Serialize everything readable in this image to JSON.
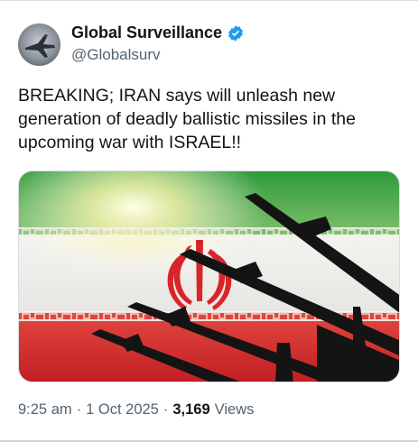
{
  "author": {
    "display_name": "Global Surveillance",
    "handle": "@Globalsurv",
    "verified": true,
    "avatar_icon": "fighter-jet-icon"
  },
  "tweet": {
    "text": "BREAKING; IRAN says will unleash new generation of deadly ballistic missiles in the upcoming war with ISRAEL!!"
  },
  "media": {
    "description_icon": "iran-flag-missiles-image"
  },
  "meta": {
    "time": "9:25 am",
    "separator": "·",
    "date": "1 Oct 2025",
    "separator2": "·",
    "views_count": "3,169",
    "views_label": "Views"
  },
  "colors": {
    "verified_blue": "#1d9bf0",
    "flag_green": "#2f9a3a",
    "flag_red": "#d8252a",
    "secondary_text": "#536471"
  }
}
